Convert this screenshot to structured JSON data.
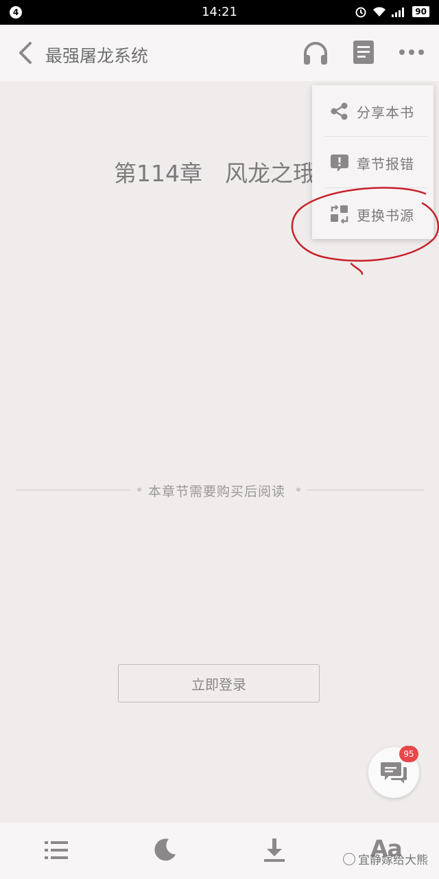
{
  "status_bar": {
    "notification_count": "4",
    "time": "14:21",
    "battery": "90"
  },
  "app_bar": {
    "title": "最强屠龙系统"
  },
  "chapter": {
    "title": "第114章　风龙之珴",
    "purchase_notice": "本章节需要购买后阅读",
    "login_button": "立即登录"
  },
  "menu": {
    "items": [
      {
        "label": "分享本书",
        "icon": "share-icon"
      },
      {
        "label": "章节报错",
        "icon": "report-error-icon"
      },
      {
        "label": "更换书源",
        "icon": "switch-source-icon"
      }
    ]
  },
  "chat": {
    "badge_count": "95"
  },
  "bottom_bar": {
    "font_label": "Aa",
    "watermark": "宜静嫁给大熊",
    "icons": [
      "catalog-icon",
      "night-mode-icon",
      "download-icon",
      "font-settings-icon"
    ]
  },
  "colors": {
    "background": "#efeceb",
    "annotation": "#c8202a",
    "badge": "#e8474a"
  }
}
